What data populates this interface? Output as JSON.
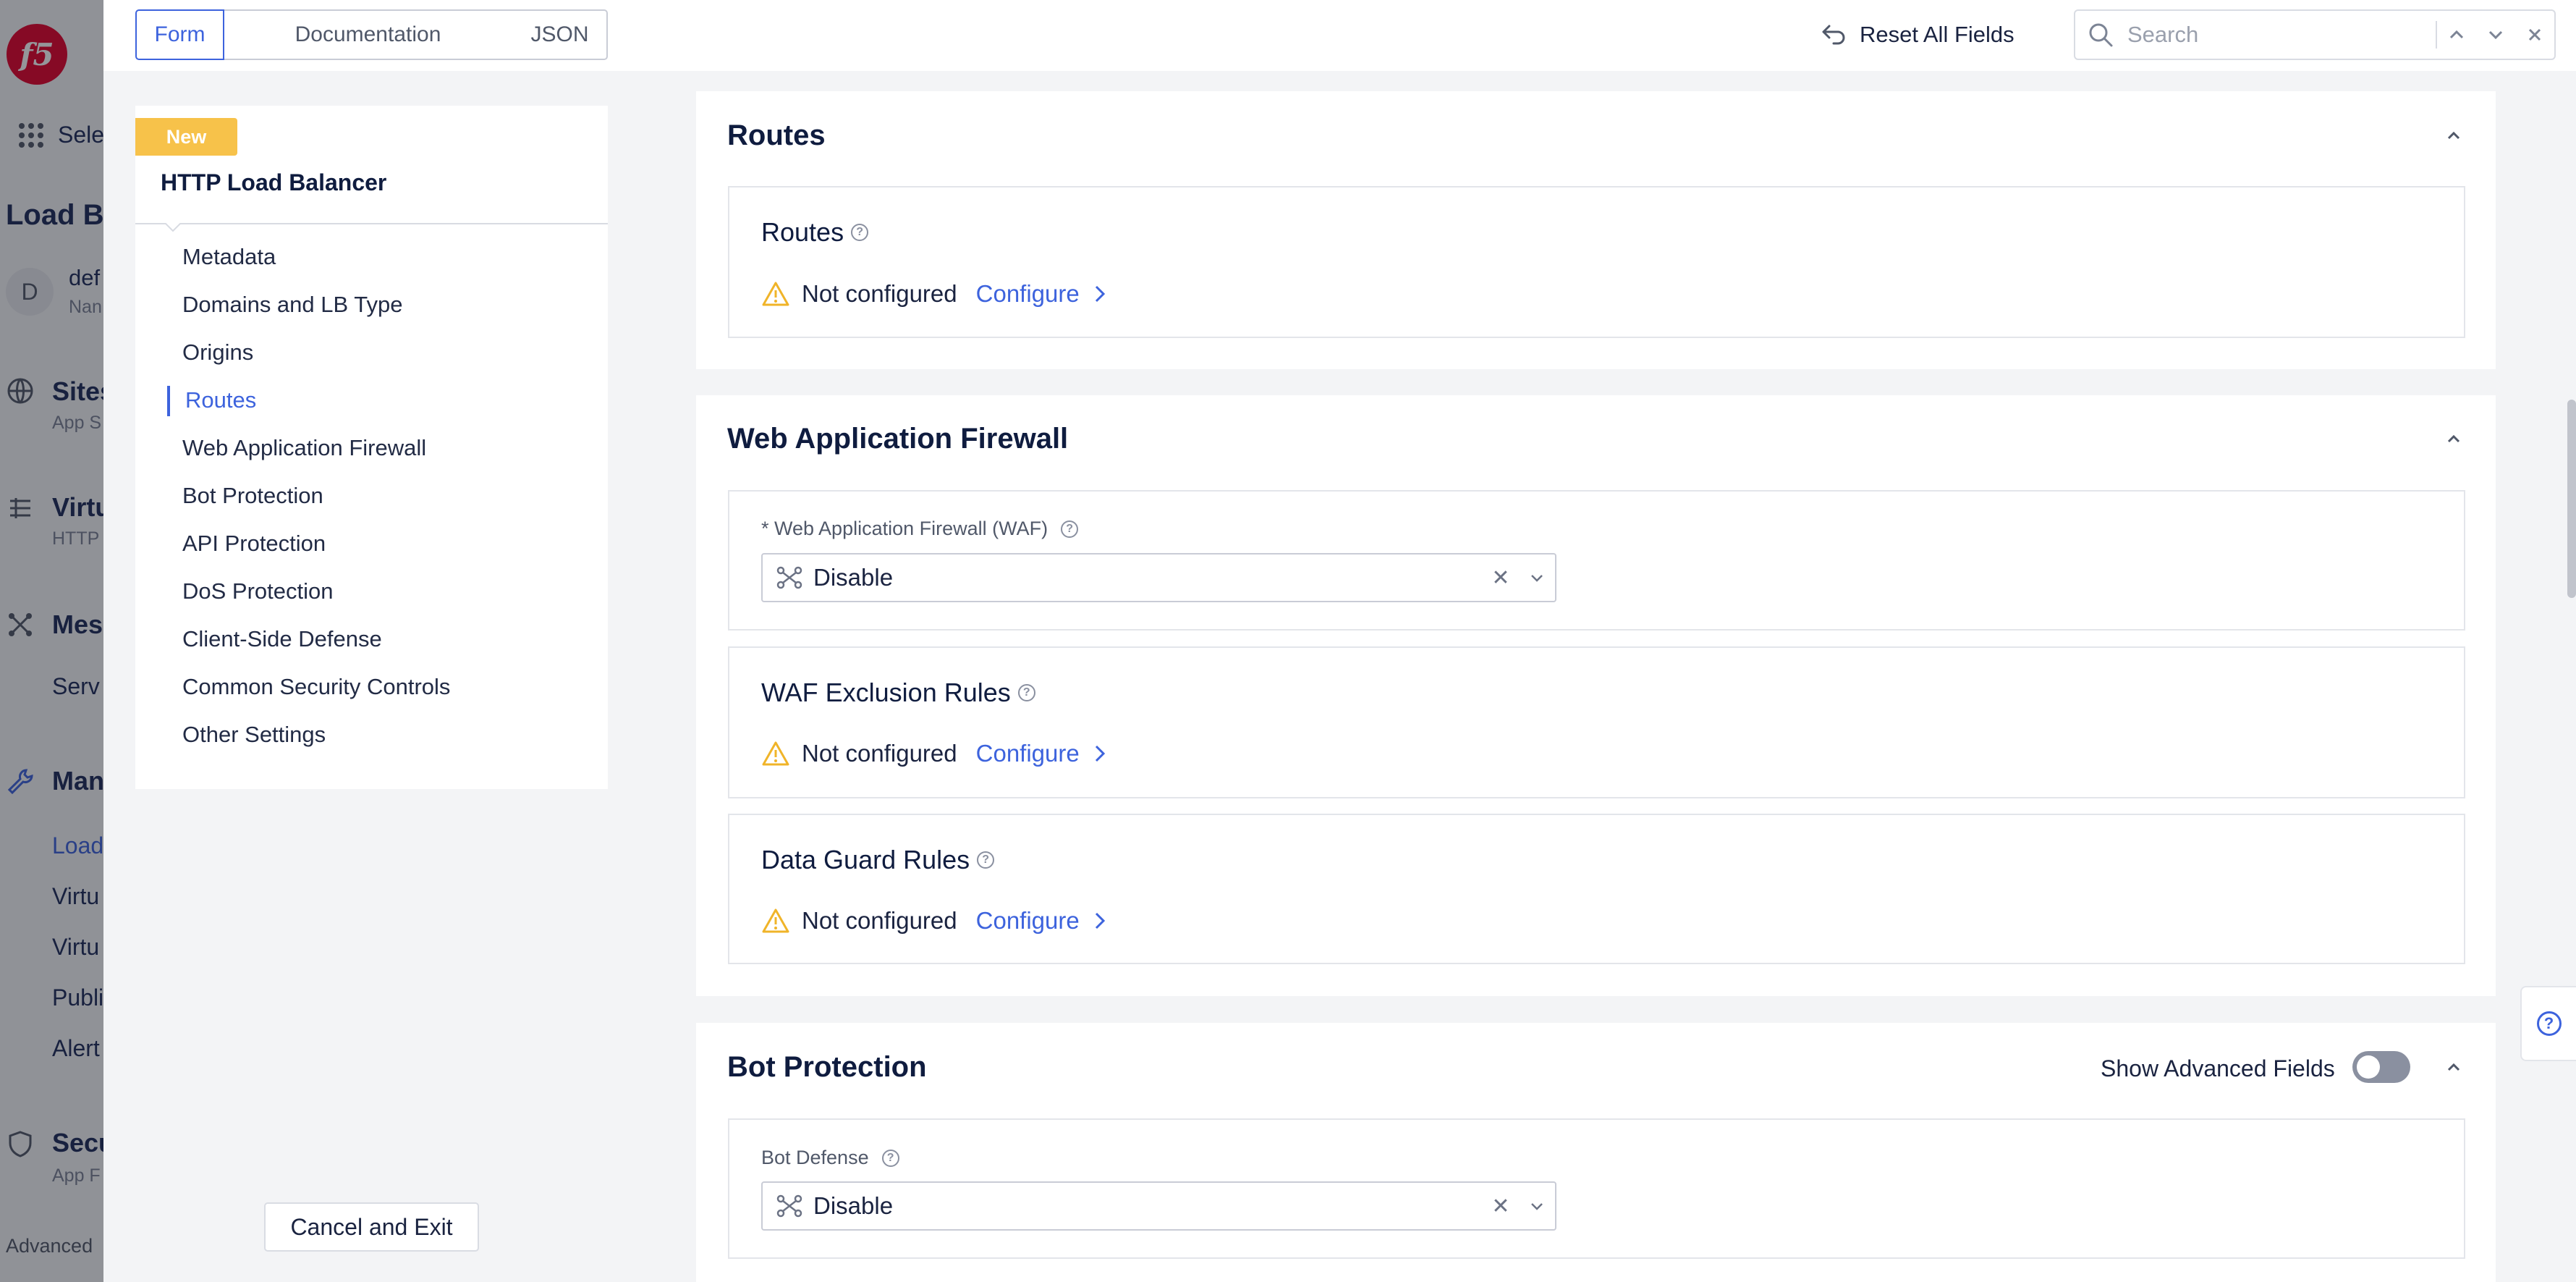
{
  "background": {
    "logo": "f5",
    "select_label": "Sele",
    "page_title_partial": "Load Ba",
    "namespace_avatar": "D",
    "namespace_name": "def",
    "namespace_sub": "Nan",
    "nav": [
      {
        "label": "Sites",
        "sub": "App S",
        "icon": "globe-icon"
      },
      {
        "label": "Virtu",
        "sub": "HTTP",
        "icon": "layers-icon"
      },
      {
        "label": "Mes",
        "sub": "",
        "icon": "mesh-icon"
      },
      {
        "label": "Serv",
        "sub": "",
        "icon": ""
      },
      {
        "label": "Man",
        "sub": "",
        "icon": "wrench-icon"
      },
      {
        "label": "Load",
        "sub": "",
        "icon": ""
      },
      {
        "label": "Virtu",
        "sub": "",
        "icon": ""
      },
      {
        "label": "Virtu",
        "sub": "",
        "icon": ""
      },
      {
        "label": "Publi",
        "sub": "",
        "icon": ""
      },
      {
        "label": "Alert",
        "sub": "",
        "icon": ""
      },
      {
        "label": "Secu",
        "sub": "App F",
        "icon": "shield-icon"
      }
    ],
    "footer": "Advanced"
  },
  "toolbar": {
    "tabs": [
      "Form",
      "Documentation",
      "JSON"
    ],
    "active_tab": "Form",
    "reset_label": "Reset All Fields",
    "search_placeholder": "Search"
  },
  "sidebar": {
    "badge": "New",
    "title": "HTTP Load Balancer",
    "items": [
      {
        "label": "Metadata"
      },
      {
        "label": "Domains and LB Type"
      },
      {
        "label": "Origins"
      },
      {
        "label": "Routes"
      },
      {
        "label": "Web Application Firewall"
      },
      {
        "label": "Bot Protection"
      },
      {
        "label": "API Protection"
      },
      {
        "label": "DoS Protection"
      },
      {
        "label": "Client-Side Defense"
      },
      {
        "label": "Common Security Controls"
      },
      {
        "label": "Other Settings"
      }
    ],
    "active_item": "Routes",
    "cancel_label": "Cancel and Exit"
  },
  "sections": {
    "routes": {
      "title": "Routes",
      "card_title": "Routes",
      "status": "Not configured",
      "action": "Configure"
    },
    "waf": {
      "title": "Web Application Firewall",
      "field_label": "* Web Application Firewall (WAF)",
      "field_value": "Disable",
      "exclusion_title": "WAF Exclusion Rules",
      "exclusion_status": "Not configured",
      "exclusion_action": "Configure",
      "dataguard_title": "Data Guard Rules",
      "dataguard_status": "Not configured",
      "dataguard_action": "Configure"
    },
    "bot": {
      "title": "Bot Protection",
      "advanced_label": "Show Advanced Fields",
      "advanced_enabled": false,
      "field_label": "Bot Defense",
      "field_value": "Disable"
    }
  },
  "colors": {
    "accent": "#3d63dd",
    "badge": "#f7c24a",
    "warning": "#f0b429",
    "brand_red": "#e4002b"
  }
}
